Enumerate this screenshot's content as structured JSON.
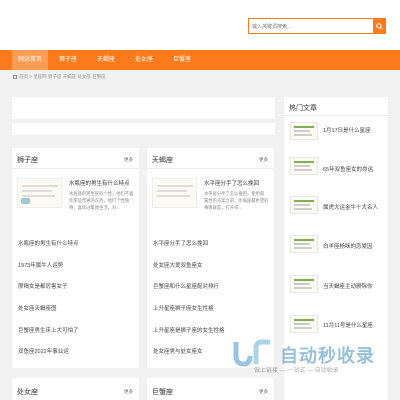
{
  "search": {
    "placeholder": "输入关键词搜索..."
  },
  "nav": {
    "items": [
      "网站首页",
      "狮子座",
      "天蝎座",
      "处女座",
      "巨蟹座"
    ]
  },
  "breadcrumb": "首页 > 星座网 狮子座 天蝎座 处女座 巨蟹座",
  "sections": [
    {
      "title": "狮子座",
      "more": "更多",
      "feature": {
        "title": "水瓶座的男生有什么特点",
        "desc": "水瓶座的男生很有个性，他们不喜欢那些普通的东西，他们个性独特，喜欢过集体生活，对..."
      },
      "items": [
        "水瓶座的男生有什么特点",
        "1973年属牛人运势",
        "摩羯女是都厉害女子",
        "处女座天蝎座图",
        "巨蟹座男生床上大可怕了",
        "双鱼座2022年事业运"
      ]
    },
    {
      "title": "天蝎座",
      "more": "更多",
      "feature": {
        "title": "水平座分手了怎么挽回",
        "desc": "水平座分手了怎么挽回，使用和　　属性的方案之前，水瓶座最希望的事情就是，打开校..."
      },
      "items": [
        "水平座分手了怎么挽回",
        "处女座大爱双鱼座女",
        "巨蟹座和什么星座配对排行",
        "上升星座狮子座女生性格",
        "上升星座是狮子座的女生性格",
        "处女座男与处女座女"
      ]
    },
    {
      "title": "处女座",
      "more": "更多"
    },
    {
      "title": "巨蟹座",
      "more": "更多"
    }
  ],
  "hot": {
    "title": "热门文章",
    "items": [
      "1月17日是什么星座",
      "65年双鱼座女的命运",
      "属虎大运金牛十大名人",
      "白羊座杨咪的恋爱因",
      "当天蝎座主动删除你",
      "11月11号是什么星座"
    ]
  },
  "watermark": {
    "text": "自动秒收录",
    "sub": "做上链接 — 一站式 — 自动收录"
  }
}
